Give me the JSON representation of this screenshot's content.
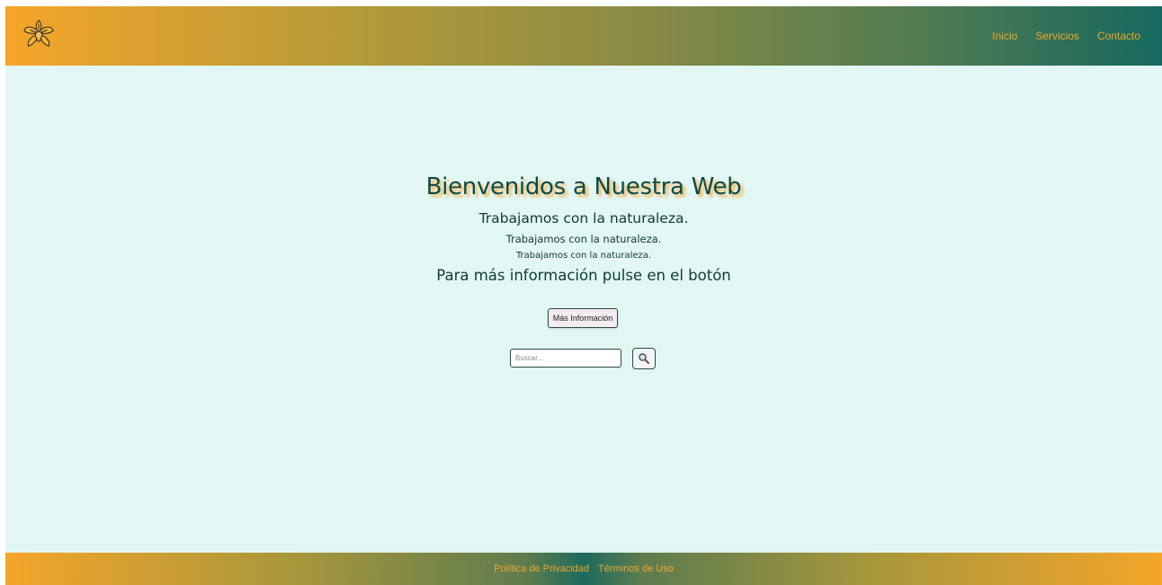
{
  "header": {
    "logo_icon": "orchid-flower-icon",
    "nav": [
      {
        "label": "Inicio"
      },
      {
        "label": "Servicios"
      },
      {
        "label": "Contacto"
      }
    ]
  },
  "hero": {
    "title": "Bienvenidos a Nuestra Web",
    "line1": "Trabajamos con la naturaleza.",
    "line2": "Trabajamos con la naturaleza.",
    "line3": "Trabajamos con la naturaleza.",
    "line4": "Para más información pulse en el botón",
    "button_label": "Más Información"
  },
  "search": {
    "placeholder": "Buscar...",
    "value": "",
    "button_icon": "magnifier-icon"
  },
  "footer": {
    "links": [
      {
        "label": "Política de Privacidad"
      },
      {
        "label": "Términos de Uso"
      }
    ]
  },
  "colors": {
    "accent": "#f0a72c",
    "primary_dark": "#0f4a42",
    "background": "#e2f7f4"
  }
}
